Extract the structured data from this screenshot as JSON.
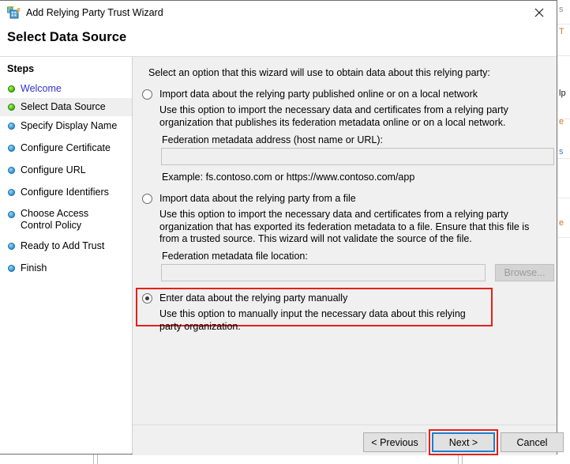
{
  "window": {
    "title": "Add Relying Party Trust Wizard",
    "icon": "adfs-wizard-icon",
    "close_label": "✕"
  },
  "header": {
    "page_title": "Select Data Source"
  },
  "sidebar": {
    "heading": "Steps",
    "items": [
      {
        "label": "Welcome",
        "bullet": "green",
        "state": "link",
        "lines": 1
      },
      {
        "label": "Select Data Source",
        "bullet": "green",
        "state": "current",
        "lines": 1
      },
      {
        "label": "Specify Display Name",
        "bullet": "blue",
        "state": "pending",
        "lines": 1
      },
      {
        "label": "Configure Certificate",
        "bullet": "blue",
        "state": "pending",
        "lines": 1
      },
      {
        "label": "Configure URL",
        "bullet": "blue",
        "state": "pending",
        "lines": 1
      },
      {
        "label": "Configure Identifiers",
        "bullet": "blue",
        "state": "pending",
        "lines": 1
      },
      {
        "label": "Choose Access Control Policy",
        "bullet": "blue",
        "state": "pending",
        "lines": 2
      },
      {
        "label": "Ready to Add Trust",
        "bullet": "blue",
        "state": "pending",
        "lines": 1
      },
      {
        "label": "Finish",
        "bullet": "blue",
        "state": "pending",
        "lines": 1
      }
    ]
  },
  "main": {
    "intro": "Select an option that this wizard will use to obtain data about this relying party:",
    "option_online": {
      "label": "Import data about the relying party published online or on a local network",
      "selected": false,
      "description": "Use this option to import the necessary data and certificates from a relying party organization that publishes its federation metadata online or on a local network.",
      "field_label": "Federation metadata address (host name or URL):",
      "field_value": "",
      "field_placeholder": "",
      "example": "Example: fs.contoso.com or https://www.contoso.com/app"
    },
    "option_file": {
      "label": "Import data about the relying party from a file",
      "selected": false,
      "description": "Use this option to import the necessary data and certificates from a relying party organization that has exported its federation metadata to a file. Ensure that this file is from a trusted source.  This wizard will not validate the source of the file.",
      "field_label": "Federation metadata file location:",
      "field_value": "",
      "field_placeholder": "",
      "browse_label": "Browse..."
    },
    "option_manual": {
      "label": "Enter data about the relying party manually",
      "selected": true,
      "description": "Use this option to manually input the necessary data about this relying party organization.",
      "highlighted": true
    }
  },
  "footer": {
    "previous_label": "< Previous",
    "next_label": "Next >",
    "cancel_label": "Cancel"
  },
  "colors": {
    "highlight_red": "#e32119",
    "focus_blue": "#1d7fd0",
    "step_link": "#3333cc",
    "bullet_green": "#4fc910",
    "bullet_blue": "#3fa3e0"
  },
  "background_window": {
    "fragments": [
      "s",
      "T",
      "lp",
      "e",
      "s",
      "e"
    ]
  }
}
